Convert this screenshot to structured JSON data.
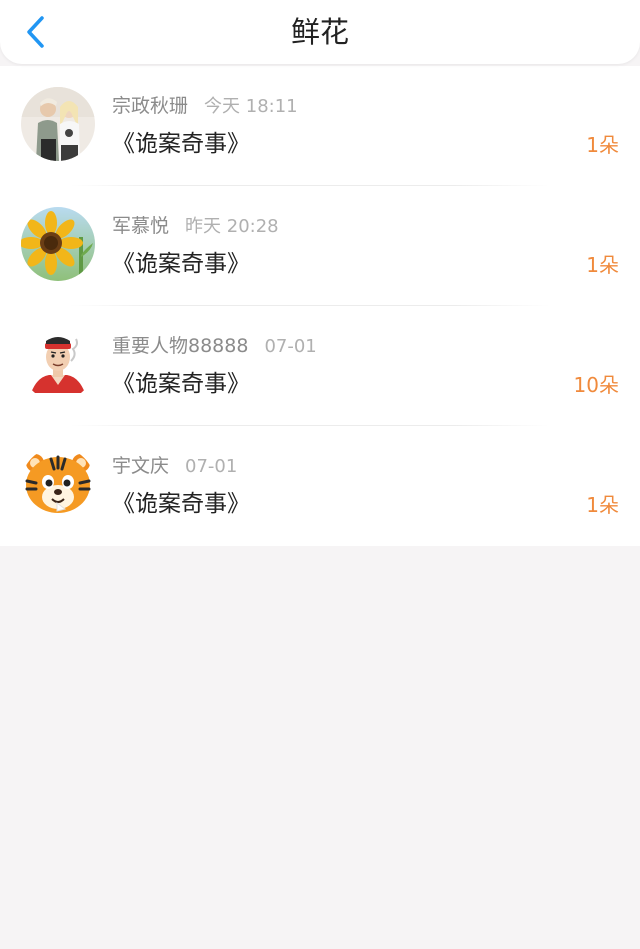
{
  "header": {
    "title": "鲜花",
    "back_icon": "chevron-left-icon",
    "accent_color": "#2196f3"
  },
  "records": [
    {
      "name": "宗政秋珊",
      "time": "今天 18:11",
      "book": "《诡案奇事》",
      "count": "1朵",
      "avatar": "couple-photo-avatar"
    },
    {
      "name": "军慕悦",
      "time": "昨天 20:28",
      "book": "《诡案奇事》",
      "count": "1朵",
      "avatar": "sunflower-avatar"
    },
    {
      "name": "重要人物88888",
      "time": "07-01",
      "book": "《诡案奇事》",
      "count": "10朵",
      "avatar": "cartoon-man-avatar"
    },
    {
      "name": "宇文庆",
      "time": "07-01",
      "book": "《诡案奇事》",
      "count": "1朵",
      "avatar": "cartoon-tiger-avatar"
    }
  ],
  "colors": {
    "count": "#f08a3c",
    "name": "#8b8b8b",
    "time": "#b0b0b0",
    "background": "#f6f4f5"
  }
}
